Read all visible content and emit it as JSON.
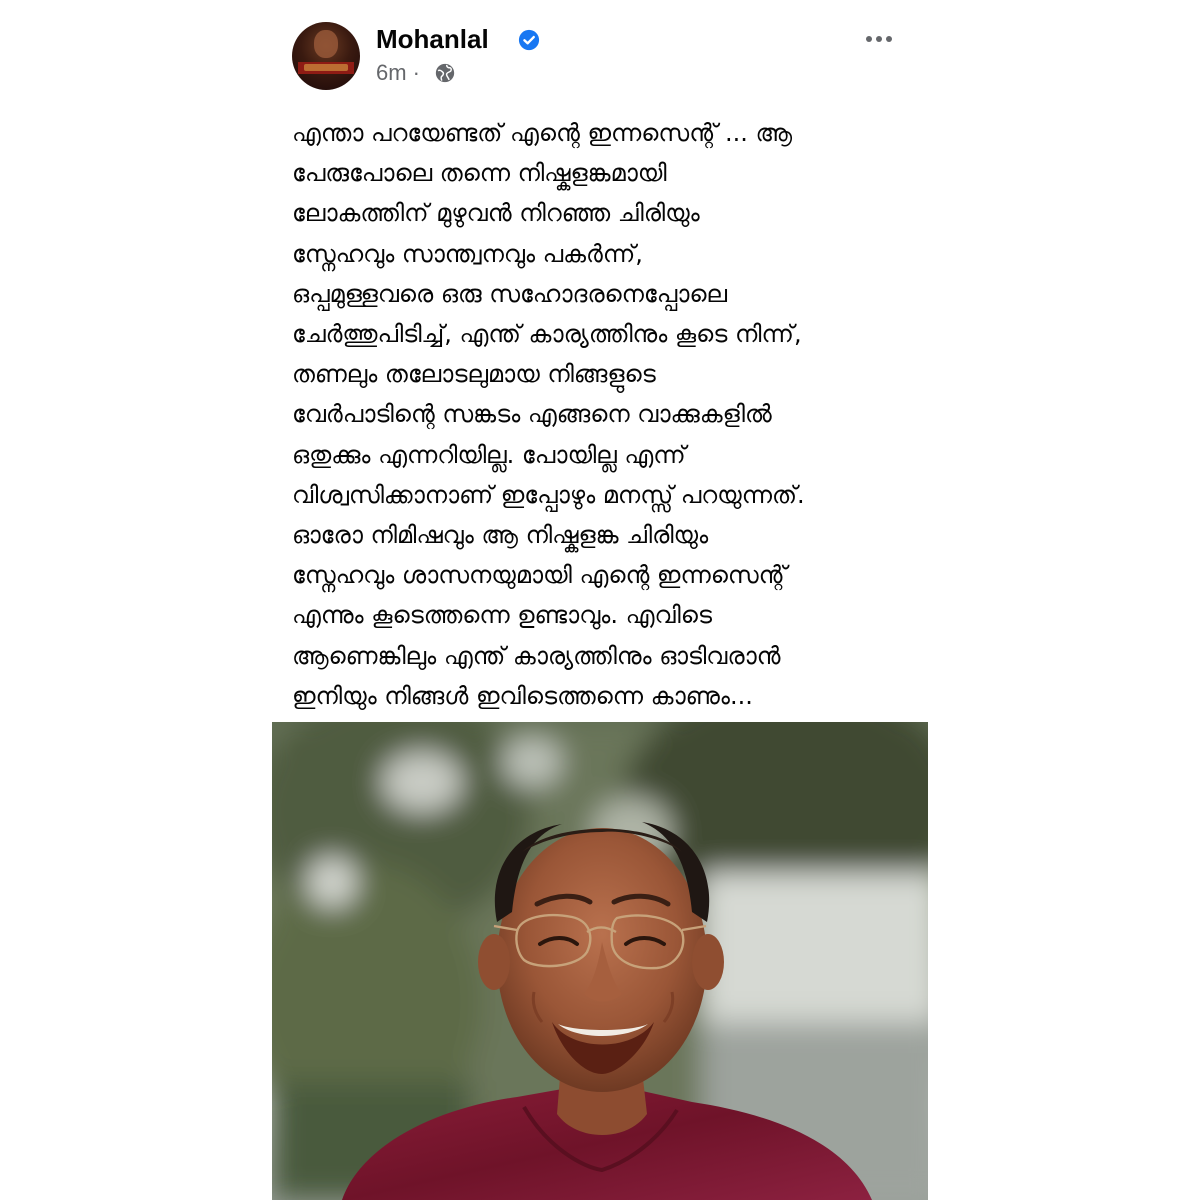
{
  "post": {
    "author": "Mohanlal",
    "timestamp": "6m",
    "separator": "·",
    "verified": true,
    "privacy_icon": "globe-icon",
    "more_icon": "more-options-icon",
    "body_lines": [
      "എന്താ പറയേണ്ടത് എന്റെ ഇന്നസെന്റ് ... ആ",
      "പേരുപോലെ തന്നെ നിഷ്കളങ്കമായി",
      "ലോകത്തിന് മുഴുവൻ നിറഞ്ഞ ചിരിയും",
      "സ്നേഹവും സാന്ത്വനവും പകർന്ന്,",
      "ഒപ്പമുള്ളവരെ ഒരു സഹോദരനെപ്പോലെ",
      "ചേർത്തുപിടിച്ച്, എന്ത് കാര്യത്തിനും കൂടെ നിന്ന്,",
      "തണലും തലോടലുമായ നിങ്ങളുടെ",
      "വേർപാടിന്റെ സങ്കടം എങ്ങനെ വാക്കുകളിൽ",
      "ഒതുക്കും എന്നറിയില്ല. പോയില്ല എന്ന്",
      "വിശ്വസിക്കാനാണ് ഇപ്പോഴും മനസ്സ് പറയുന്നത്.",
      "ഓരോ നിമിഷവും ആ നിഷ്കളങ്ക ചിരിയും",
      "സ്നേഹവും ശാസനയുമായി എന്റെ ഇന്നസെന്റ്",
      "എന്നും കൂടെത്തന്നെ ഉണ്ടാവും. എവിടെ",
      "ആണെങ്കിലും എന്ത് കാര്യത്തിനും ഓടിവരാൻ",
      "ഇനിയും നിങ്ങൾ ഇവിടെത്തന്നെ കാണും..."
    ]
  },
  "colors": {
    "verified_badge": "#1877f2",
    "meta_text": "#65676b",
    "body_text": "#050505",
    "shirt": "#7a1630"
  }
}
